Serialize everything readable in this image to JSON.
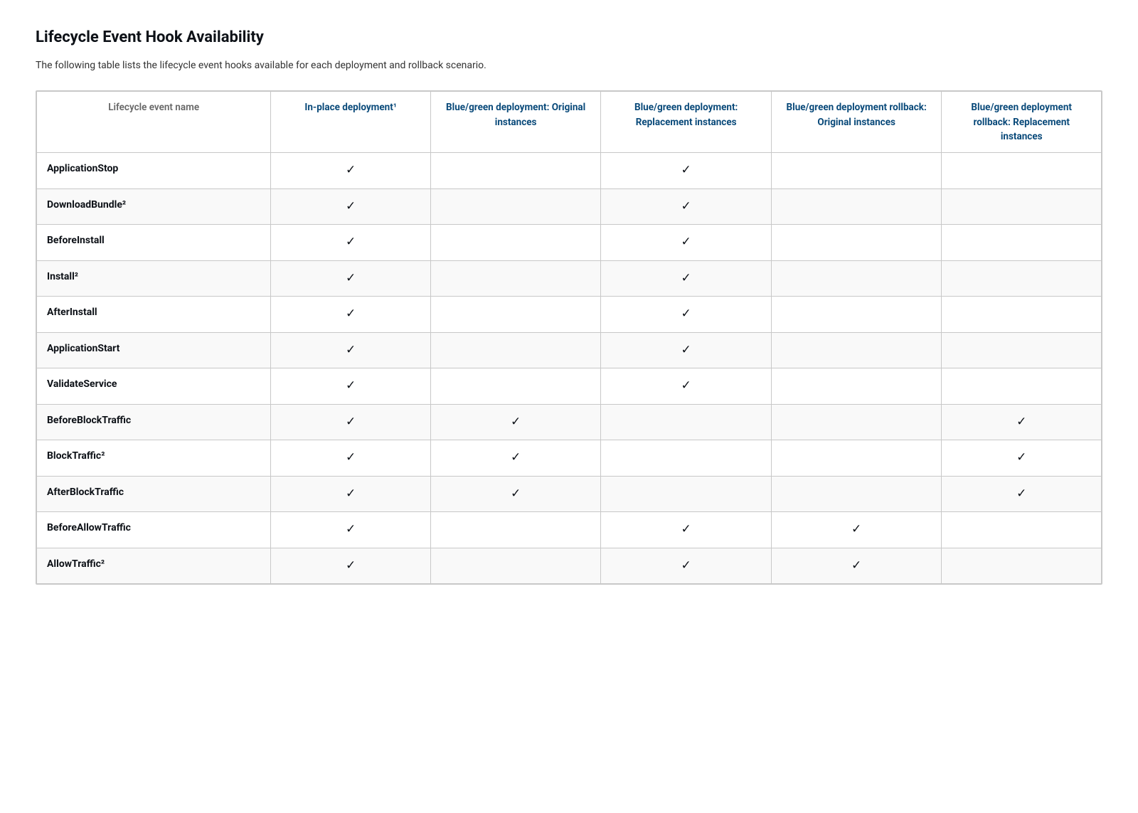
{
  "page": {
    "title": "Lifecycle Event Hook Availability",
    "description": "The following table lists the lifecycle event hooks available for each deployment and rollback scenario."
  },
  "table": {
    "headers": [
      {
        "id": "event-name",
        "label": "Lifecycle event name",
        "style": "normal"
      },
      {
        "id": "inplace",
        "label": "In-place deployment¹",
        "style": "bold-blue"
      },
      {
        "id": "bluegreen-original",
        "label": "Blue/green deployment: Original instances",
        "style": "bold-blue"
      },
      {
        "id": "bluegreen-replacement",
        "label": "Blue/green deployment: Replacement instances",
        "style": "bold-blue"
      },
      {
        "id": "bluegreen-rollback-original",
        "label": "Blue/green deployment rollback: Original instances",
        "style": "bold-blue"
      },
      {
        "id": "bluegreen-rollback-replacement",
        "label": "Blue/green deployment rollback: Replacement instances",
        "style": "bold-blue"
      }
    ],
    "rows": [
      {
        "name": "ApplicationStop",
        "inplace": true,
        "bluegreen_original": false,
        "bluegreen_replacement": true,
        "bluegreen_rollback_original": false,
        "bluegreen_rollback_replacement": false
      },
      {
        "name": "DownloadBundle²",
        "inplace": true,
        "bluegreen_original": false,
        "bluegreen_replacement": true,
        "bluegreen_rollback_original": false,
        "bluegreen_rollback_replacement": false
      },
      {
        "name": "BeforeInstall",
        "inplace": true,
        "bluegreen_original": false,
        "bluegreen_replacement": true,
        "bluegreen_rollback_original": false,
        "bluegreen_rollback_replacement": false
      },
      {
        "name": "Install²",
        "inplace": true,
        "bluegreen_original": false,
        "bluegreen_replacement": true,
        "bluegreen_rollback_original": false,
        "bluegreen_rollback_replacement": false
      },
      {
        "name": "AfterInstall",
        "inplace": true,
        "bluegreen_original": false,
        "bluegreen_replacement": true,
        "bluegreen_rollback_original": false,
        "bluegreen_rollback_replacement": false
      },
      {
        "name": "ApplicationStart",
        "inplace": true,
        "bluegreen_original": false,
        "bluegreen_replacement": true,
        "bluegreen_rollback_original": false,
        "bluegreen_rollback_replacement": false
      },
      {
        "name": "ValidateService",
        "inplace": true,
        "bluegreen_original": false,
        "bluegreen_replacement": true,
        "bluegreen_rollback_original": false,
        "bluegreen_rollback_replacement": false
      },
      {
        "name": "BeforeBlockTraffic",
        "inplace": true,
        "bluegreen_original": true,
        "bluegreen_replacement": false,
        "bluegreen_rollback_original": false,
        "bluegreen_rollback_replacement": true
      },
      {
        "name": "BlockTraffic²",
        "inplace": true,
        "bluegreen_original": true,
        "bluegreen_replacement": false,
        "bluegreen_rollback_original": false,
        "bluegreen_rollback_replacement": true
      },
      {
        "name": "AfterBlockTraffic",
        "inplace": true,
        "bluegreen_original": true,
        "bluegreen_replacement": false,
        "bluegreen_rollback_original": false,
        "bluegreen_rollback_replacement": true
      },
      {
        "name": "BeforeAllowTraffic",
        "inplace": true,
        "bluegreen_original": false,
        "bluegreen_replacement": true,
        "bluegreen_rollback_original": true,
        "bluegreen_rollback_replacement": false
      },
      {
        "name": "AllowTraffic²",
        "inplace": true,
        "bluegreen_original": false,
        "bluegreen_replacement": true,
        "bluegreen_rollback_original": true,
        "bluegreen_rollback_replacement": false
      }
    ],
    "checkmark": "✓"
  }
}
